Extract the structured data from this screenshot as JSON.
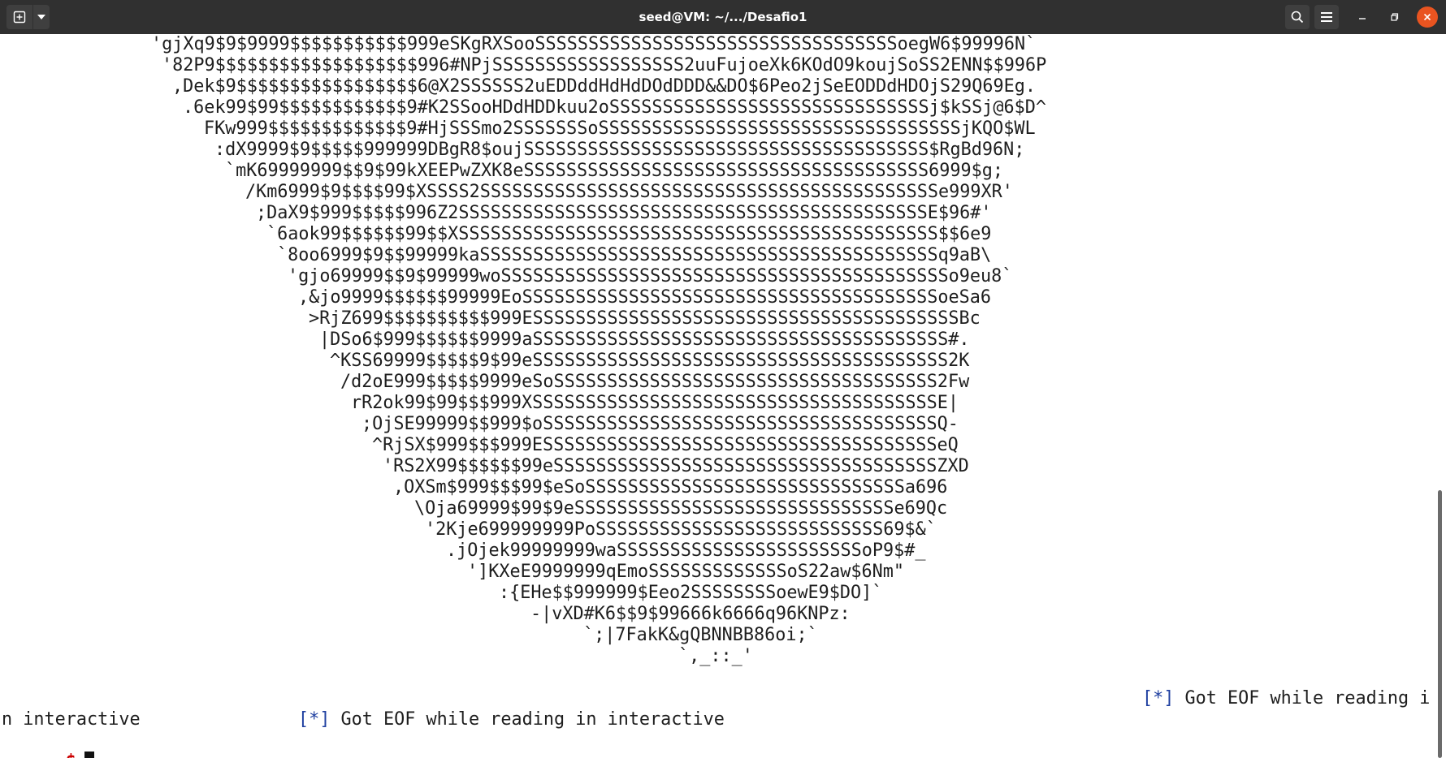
{
  "window": {
    "title": "seed@VM: ~/.../Desafio1"
  },
  "colors": {
    "titlebar": "#303030",
    "terminal_bg": "#ffffff",
    "text": "#1e1e1e",
    "prompt": "#cc0000",
    "bracket": "#1f3fa0",
    "close": "#e95420"
  },
  "icons": {
    "new_tab": "new-tab-icon",
    "dropdown": "chevron-down-icon",
    "search": "search-icon",
    "menu": "hamburger-menu-icon",
    "minimize": "minimize-icon",
    "maximize": "maximize-icon",
    "close": "close-icon"
  },
  "terminal": {
    "art_lines": [
      "'gjXq9$9$9999$$$$$$$$$$$999eSKgRXSooSSSSSSSSSSSSSSSSSSSSSSSSSSSSSSSSSSoegW6$99996N`",
      "'82P9$$$$$$$$$$$$$$$$$$$996#NPjSSSSSSSSSSSSSSSSSS2uuFujoeXk6KOdO9koujSoSS2ENN$$996P",
      ",Dek$9$$$$$$$$$$$$$$$$$6@X2SSSSSS2uEDDddHdHdDOdDDD&&DO$6Peo2jSeEODDdHDOjS29Q69Eg.",
      ".6ek99$99$$$$$$$$$$$$9#K2SSooHDdHDDkuu2oSSSSSSSSSSSSSSSSSSSSSSSSSSSSSSj$kSSj@6$D^",
      "FKw999$$$$$$$$$$$$$9#HjSSSmo2SSSSSSSoSSSSSSSSSSSSSSSSSSSSSSSSSSSSSSSSSSjKQO$WL",
      ":dX9999$9$$$$$999999DBgR8$oujSSSSSSSSSSSSSSSSSSSSSSSSSSSSSSSSSSSSSS$RgBd96N;",
      "`mK69999999$$9$99kXEEPwZXK8eSSSSSSSSSSSSSSSSSSSSSSSSSSSSSSSSSSSSSS6999$g;",
      "/Km6999$9$$$$99$XSSSS2SSSSSSSSSSSSSSSSSSSSSSSSSSSSSSSSSSSSSSSSSSSe999XR'",
      ";DaX9$999$$$$$996Z2SSSSSSSSSSSSSSSSSSSSSSSSSSSSSSSSSSSSSSSSSSSSE$96#'",
      "`6aok99$$$$$$99$$XSSSSSSSSSSSSSSSSSSSSSSSSSSSSSSSSSSSSSSSSSSSSS$$6e9",
      "`8oo6999$9$$99999kaSSSSSSSSSSSSSSSSSSSSSSSSSSSSSSSSSSSSSSSSSSSq9aB\\",
      "'gjo69999$$9$99999woSSSSSSSSSSSSSSSSSSSSSSSSSSSSSSSSSSSSSSSSSSo9eu8`",
      ",&jo9999$$$$$$99999EoSSSSSSSSSSSSSSSSSSSSSSSSSSSSSSSSSSSSSSSoeSa6",
      ">RjZ699$$$$$$$$$$999ESSSSSSSSSSSSSSSSSSSSSSSSSSSSSSSSSSSSSSSSBc",
      "|DSo6$999$$$$$$9999aSSSSSSSSSSSSSSSSSSSSSSSSSSSSSSSSSSSSSSS#.",
      "^KSS69999$$$$$9$99eSSSSSSSSSSSSSSSSSSSSSSSSSSSSSSSSSSSSSSS2K",
      "/d2oE999$$$$$9999eSoSSSSSSSSSSSSSSSSSSSSSSSSSSSSSSSSSSSS2Fw",
      "rR2ok99$99$$$999XSSSSSSSSSSSSSSSSSSSSSSSSSSSSSSSSSSSSSSE|",
      ";OjSE99999$$999$oSSSSSSSSSSSSSSSSSSSSSSSSSSSSSSSSSSSSSQ-",
      "^RjSX$999$$$999ESSSSSSSSSSSSSSSSSSSSSSSSSSSSSSSSSSSSSeQ",
      "'RS2X99$$$$$$99eSSSSSSSSSSSSSSSSSSSSSSSSSSSSSSSSSSSSZXD",
      ",OXSm$999$$$99$eSoSSSSSSSSSSSSSSSSSSSSSSSSSSSSSSa696",
      "\\Oja69999$99$9eSSSSSSSSSSSSSSSSSSSSSSSSSSSSSSe69Qc",
      "'2Kje699999999PoSSSSSSSSSSSSSSSSSSSSSSSSSSS69$&`",
      ".jOjek99999999waSSSSSSSSSSSSSSSSSSSSSSSoP9$#_",
      "']KXeE9999999qEmoSSSSSSSSSSSSSoS22aw$6Nm\"",
      ":{EHe$$999999$Eeo2SSSSSSSSoewE9$DO]`",
      "-|vXD#K6$$9$99666k6666q96KNPz:",
      "`;|7FakK&gQBNNBB86oi;`",
      "`,_::_'"
    ],
    "status_right": "[*] Got EOF while reading i",
    "status_wrap": "n interactive",
    "status_second": "[*] Got EOF while reading in interactive",
    "prompt": "$"
  }
}
